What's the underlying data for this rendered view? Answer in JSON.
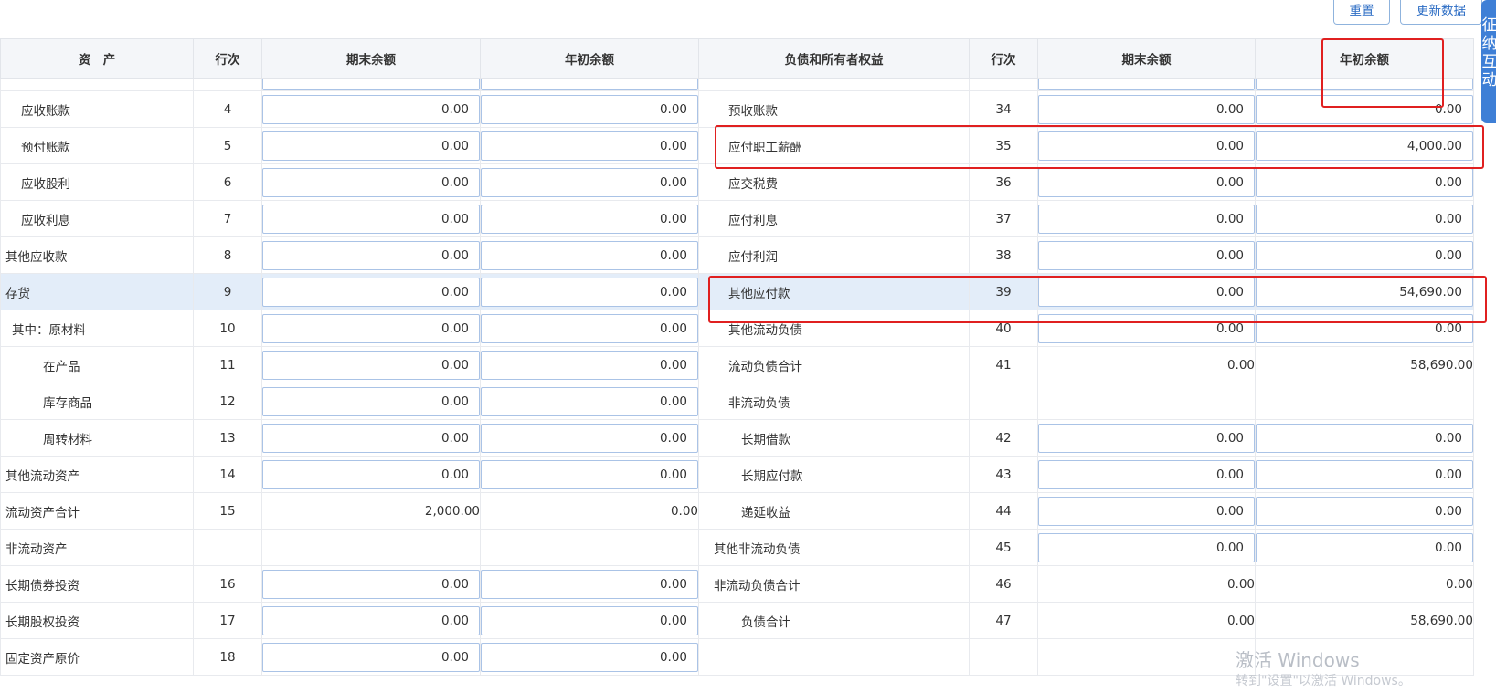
{
  "toolbar": {
    "reset_label": "重置",
    "update_label": "更新数据"
  },
  "side_tab": {
    "label": "征纳互动"
  },
  "headers": {
    "assets": "资　产",
    "line_left": "行次",
    "end_left": "期末余额",
    "begin_left": "年初余额",
    "liab": "负债和所有者权益",
    "line_right": "行次",
    "end_right": "期末余额",
    "begin_right": "年初余额"
  },
  "rows": [
    {
      "l_label": "应收账款",
      "l_line": "4",
      "l_end": "0.00",
      "l_begin": "0.00",
      "r_label": "预收账款",
      "r_line": "34",
      "r_end": "0.00",
      "r_begin": "0.00"
    },
    {
      "l_label": "预付账款",
      "l_line": "5",
      "l_end": "0.00",
      "l_begin": "0.00",
      "r_label": "应付职工薪酬",
      "r_line": "35",
      "r_end": "0.00",
      "r_begin": "4,000.00"
    },
    {
      "l_label": "应收股利",
      "l_line": "6",
      "l_end": "0.00",
      "l_begin": "0.00",
      "r_label": "应交税费",
      "r_line": "36",
      "r_end": "0.00",
      "r_begin": "0.00"
    },
    {
      "l_label": "应收利息",
      "l_line": "7",
      "l_end": "0.00",
      "l_begin": "0.00",
      "r_label": "应付利息",
      "r_line": "37",
      "r_end": "0.00",
      "r_begin": "0.00"
    },
    {
      "l_label": "其他应收款",
      "l_line": "8",
      "l_end": "0.00",
      "l_begin": "0.00",
      "r_label": "应付利润",
      "r_line": "38",
      "r_end": "0.00",
      "r_begin": "0.00"
    },
    {
      "l_label": "存货",
      "l_line": "9",
      "l_end": "0.00",
      "l_begin": "0.00",
      "r_label": "其他应付款",
      "r_line": "39",
      "r_end": "0.00",
      "r_begin": "54,690.00"
    },
    {
      "l_label": "其中：原材料",
      "l_line": "10",
      "l_end": "0.00",
      "l_begin": "0.00",
      "r_label": "其他流动负债",
      "r_line": "40",
      "r_end": "0.00",
      "r_begin": "0.00"
    },
    {
      "l_label": "在产品",
      "l_line": "11",
      "l_end": "0.00",
      "l_begin": "0.00",
      "r_label": "流动负债合计",
      "r_line": "41",
      "r_end": "0.00",
      "r_begin": "58,690.00"
    },
    {
      "l_label": "库存商品",
      "l_line": "12",
      "l_end": "0.00",
      "l_begin": "0.00",
      "r_label": "非流动负债",
      "r_line": "",
      "r_end": "",
      "r_begin": ""
    },
    {
      "l_label": "周转材料",
      "l_line": "13",
      "l_end": "0.00",
      "l_begin": "0.00",
      "r_label": "长期借款",
      "r_line": "42",
      "r_end": "0.00",
      "r_begin": "0.00"
    },
    {
      "l_label": "其他流动资产",
      "l_line": "14",
      "l_end": "0.00",
      "l_begin": "0.00",
      "r_label": "长期应付款",
      "r_line": "43",
      "r_end": "0.00",
      "r_begin": "0.00"
    },
    {
      "l_label": "流动资产合计",
      "l_line": "15",
      "l_end": "2,000.00",
      "l_begin": "0.00",
      "r_label": "递延收益",
      "r_line": "44",
      "r_end": "0.00",
      "r_begin": "0.00"
    },
    {
      "l_label": "非流动资产",
      "l_line": "",
      "l_end": "",
      "l_begin": "",
      "r_label": "其他非流动负债",
      "r_line": "45",
      "r_end": "0.00",
      "r_begin": "0.00"
    },
    {
      "l_label": "长期债券投资",
      "l_line": "16",
      "l_end": "0.00",
      "l_begin": "0.00",
      "r_label": "非流动负债合计",
      "r_line": "46",
      "r_end": "0.00",
      "r_begin": "0.00"
    },
    {
      "l_label": "长期股权投资",
      "l_line": "17",
      "l_end": "0.00",
      "l_begin": "0.00",
      "r_label": "负债合计",
      "r_line": "47",
      "r_end": "0.00",
      "r_begin": "58,690.00"
    },
    {
      "l_label": "固定资产原价",
      "l_line": "18",
      "l_end": "0.00",
      "l_begin": "0.00",
      "r_label": "",
      "r_line": "",
      "r_end": "",
      "r_begin": ""
    }
  ],
  "watermark": {
    "title": "激活 Windows",
    "subtitle": "转到\"设置\"以激活 Windows。"
  },
  "colors": {
    "accent": "#3e7fd6",
    "highlight_row": "#e3edf9",
    "annotation": "#e02020",
    "input_border": "#aac3e6"
  }
}
